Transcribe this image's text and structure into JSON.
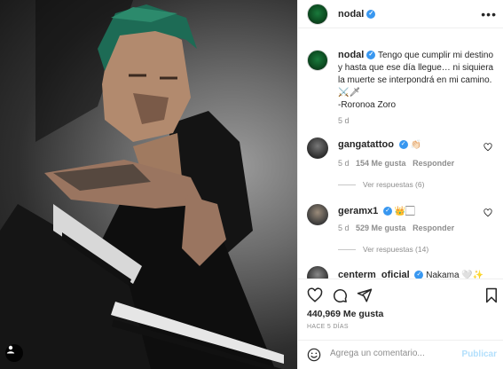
{
  "post": {
    "username": "nodal",
    "more_icon": "more-horizontal-icon",
    "caption_text": "Tengo que cumplir mi destino y hasta que ese día llegue… ni siquiera la muerte se interpondrá en mi camino. ⚔️🗡",
    "caption_author_line": "-Roronoa Zoro",
    "caption_time": "5 d"
  },
  "comments": [
    {
      "username": "gangatattoo",
      "text": "👏🏻",
      "time": "5 d",
      "likes": "154 Me gusta",
      "reply": "Responder",
      "view_replies": "Ver respuestas (6)"
    },
    {
      "username": "geramx1",
      "text": "👑🏻",
      "time": "5 d",
      "likes": "529 Me gusta",
      "reply": "Responder",
      "view_replies": "Ver respuestas (14)"
    },
    {
      "username": "centerm_oficial",
      "text": "Nakama 🤍✨"
    }
  ],
  "actions": {
    "like_count": "440,969 Me gusta",
    "time_ago": "HACE 5 DÍAS"
  },
  "add_comment": {
    "placeholder": "Agrega un comentario...",
    "publish_label": "Publicar"
  },
  "colors": {
    "accent_blue": "#3897f0",
    "publish_disabled": "#b2dffc",
    "muted_text": "#8e8e8e"
  }
}
